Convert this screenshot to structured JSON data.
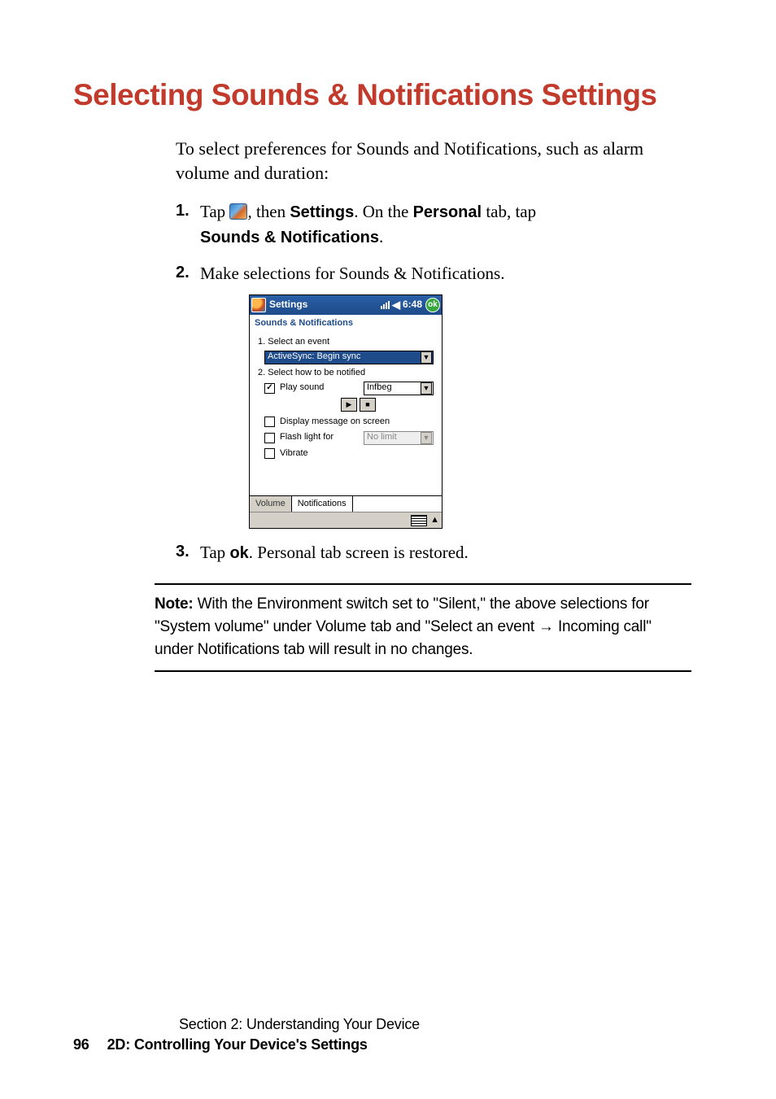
{
  "title": "Selecting Sounds & Notifications Settings",
  "intro": "To select preferences for Sounds and Notifications, such as alarm volume and duration:",
  "steps": {
    "s1": {
      "a": "Tap ",
      "b": ", then ",
      "settings": "Settings",
      "c": ". On the ",
      "personal": "Personal",
      "d": " tab, tap ",
      "sn": "Sounds & Notifications",
      "e": "."
    },
    "s2": "Make selections for Sounds & Notifications.",
    "s3": {
      "a": "Tap ",
      "ok": "ok",
      "b": ". Personal tab screen is restored."
    }
  },
  "ppc": {
    "title": "Settings",
    "time": "6:48",
    "ok": "ok",
    "subtitle": "Sounds & Notifications",
    "label1": "1. Select an event",
    "select1": "ActiveSync: Begin sync",
    "label2": "2. Select how to be notified",
    "playSound": "Play sound",
    "soundName": "Infbeg",
    "displayMsg": "Display message on screen",
    "flash": "Flash light for",
    "flashVal": "No limit",
    "vibrate": "Vibrate",
    "tabVolume": "Volume",
    "tabNotifications": "Notifications"
  },
  "note": {
    "label": "Note:",
    "body1": " With the Environment switch set to \"Silent,\" the above selections for \"System volume\" under Volume tab and \"Select an event ",
    "arrow": "→",
    "body2": " Incoming call\" under Notifications tab will result in no changes."
  },
  "footer": {
    "section": "Section 2: Understanding Your Device",
    "page": "96",
    "chapter": "2D: Controlling Your Device's Settings"
  }
}
